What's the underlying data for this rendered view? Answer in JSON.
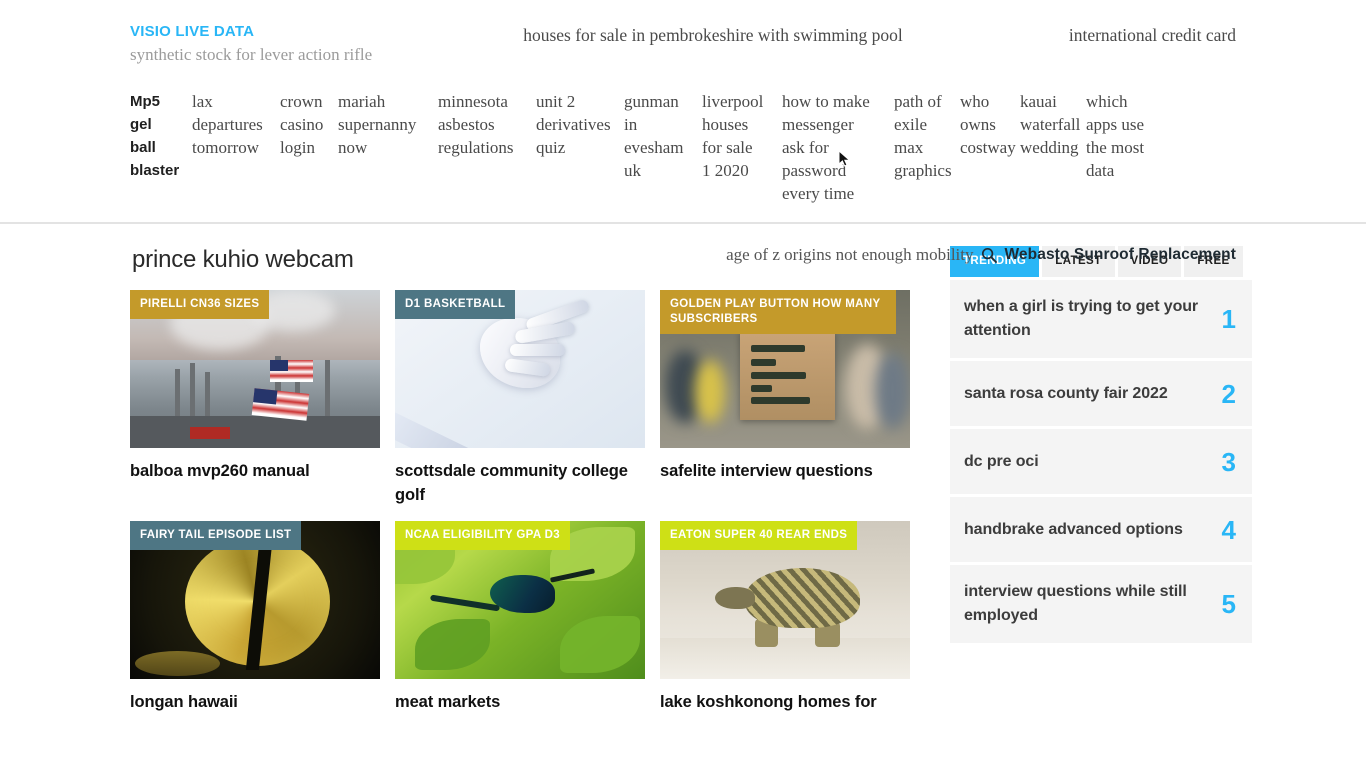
{
  "header": {
    "brand_name": "VISIO LIVE DATA",
    "brand_tagline": "synthetic stock for lever action rifle",
    "center_text": "houses for sale in pembrokeshire with swimming pool",
    "right_text": "international credit card",
    "accent_color": "#29b6f6"
  },
  "nav": {
    "items": [
      "Mp5 gel ball blaster",
      "lax departures tomorrow",
      "crown casino login",
      "mariah supernanny now",
      "minnesota asbestos regulations",
      "unit 2 derivatives quiz",
      "gunman in evesham uk",
      "liverpool houses for sale 1 2020",
      "how to make messenger ask for password every time",
      "path of exile max graphics",
      "who owns costway",
      "kauai waterfall wedding",
      "which apps use the most data"
    ]
  },
  "search": {
    "placeholder": "age of z origins not enough mobility",
    "icon": "search-icon",
    "value": "Webasto Sunroof Replacement"
  },
  "main": {
    "page_title": "prince kuhio webcam",
    "cards": [
      {
        "badge": "PIRELLI CN36 SIZES",
        "badge_color": "#c49a2a",
        "title": "balboa mvp260 manual",
        "art": "a-refinery"
      },
      {
        "badge": "D1 BASKETBALL",
        "badge_color": "#4e7684",
        "title": "scottsdale community college golf",
        "art": "a-hand"
      },
      {
        "badge": "GOLDEN PLAY BUTTON HOW MANY SUBSCRIBERS",
        "badge_color": "#c49a2a",
        "title": "safelite interview questions",
        "art": "a-protest"
      },
      {
        "badge": "FAIRY TAIL EPISODE LIST",
        "badge_color": "#4e7684",
        "title": "longan hawaii",
        "art": "a-coin"
      },
      {
        "badge": "NCAA ELIGIBILITY GPA D3",
        "badge_color": "#cee016",
        "title": "meat markets",
        "art": "a-bird"
      },
      {
        "badge": "EATON SUPER 40 REAR ENDS",
        "badge_color": "#cee016",
        "title": "lake koshkonong homes for",
        "art": "a-tort"
      }
    ]
  },
  "sidebar": {
    "tabs": [
      {
        "label": "TRENDING",
        "active": true
      },
      {
        "label": "LATEST",
        "active": false
      },
      {
        "label": "VIDEO",
        "active": false
      },
      {
        "label": "FREE",
        "active": false
      }
    ],
    "ranked_items": [
      {
        "rank": "1",
        "label": "when a girl is trying to get your attention"
      },
      {
        "rank": "2",
        "label": "santa rosa county fair 2022"
      },
      {
        "rank": "3",
        "label": "dc pre oci"
      },
      {
        "rank": "4",
        "label": "handbrake advanced options"
      },
      {
        "rank": "5",
        "label": "interview questions while still employed"
      }
    ]
  }
}
